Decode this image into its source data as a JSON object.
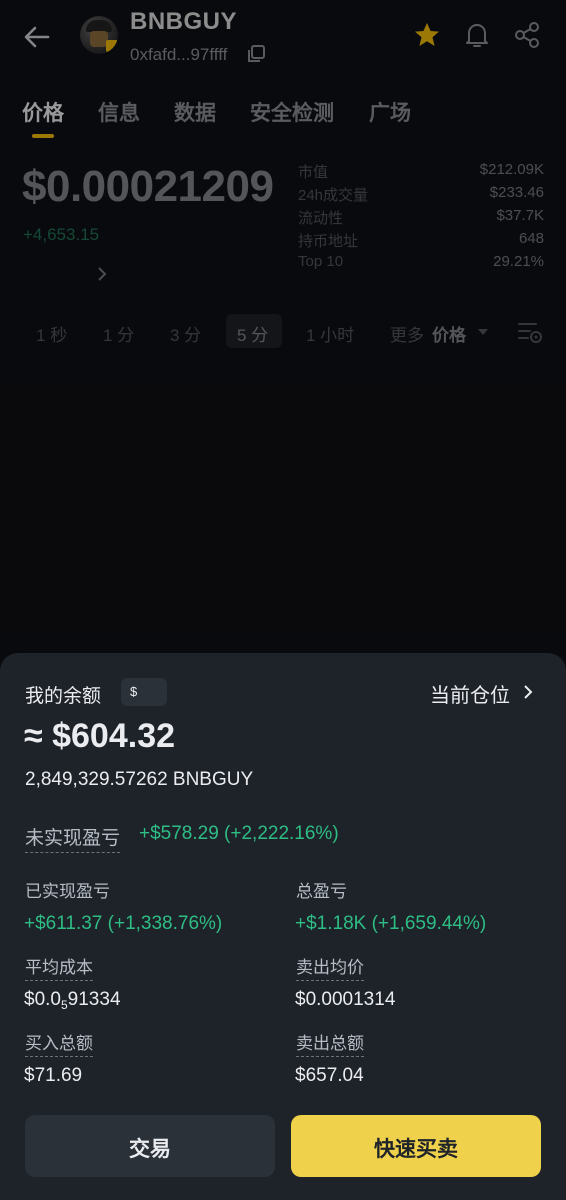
{
  "header": {
    "token_name": "BNBGUY",
    "token_address": "0xfafd...97ffff",
    "icons": [
      "back-arrow-icon",
      "token-avatar",
      "copy-icon",
      "star-icon",
      "bell-icon",
      "share-icon"
    ],
    "accent_color": "#f0b90b"
  },
  "tabs": [
    {
      "label": "价格",
      "active": true
    },
    {
      "label": "信息",
      "active": false
    },
    {
      "label": "数据",
      "active": false
    },
    {
      "label": "安全检测",
      "active": false
    },
    {
      "label": "广场",
      "active": false
    }
  ],
  "price_section": {
    "price": "$0.00021209",
    "change": "+4,653.15",
    "stats": [
      {
        "label": "市值",
        "value": "$212.09K"
      },
      {
        "label": "24h成交量",
        "value": "$233.46"
      },
      {
        "label": "流动性",
        "value": "$37.7K"
      },
      {
        "label": "持币地址",
        "value": "648"
      },
      {
        "label": "Top 10",
        "value": "29.21%"
      }
    ]
  },
  "intervals": {
    "items": [
      "1 秒",
      "1 分",
      "3 分",
      "5 分",
      "1 小时",
      "更多"
    ],
    "active": "5 分",
    "price_dropdown": "价格"
  },
  "sheet": {
    "balance_label": "我的余额",
    "currency_badge": "$",
    "position_link": "当前仓位",
    "balance_value": "≈ $604.32",
    "balance_token": "2,849,329.57262 BNBGUY",
    "unrealized_label": "未实现盈亏",
    "unrealized_value": "+$578.29 (+2,222.16%)",
    "realized_label": "已实现盈亏",
    "realized_value": "+$611.37 (+1,338.76%)",
    "total_pnl_label": "总盈亏",
    "total_pnl_value": "+$1.18K (+1,659.44%)",
    "avg_cost_label": "平均成本",
    "avg_cost_prefix": "$0.0",
    "avg_cost_zeros": "5",
    "avg_cost_digits": "91334",
    "avg_sell_label": "卖出均价",
    "avg_sell_value": "$0.0001314",
    "buy_total_label": "买入总额",
    "buy_total_value": "$71.69",
    "sell_total_label": "卖出总额",
    "sell_total_value": "$657.04",
    "trade_button": "交易",
    "quick_button": "快速买卖",
    "green_color": "#2ebd85",
    "quick_button_color": "#f0d14b"
  }
}
